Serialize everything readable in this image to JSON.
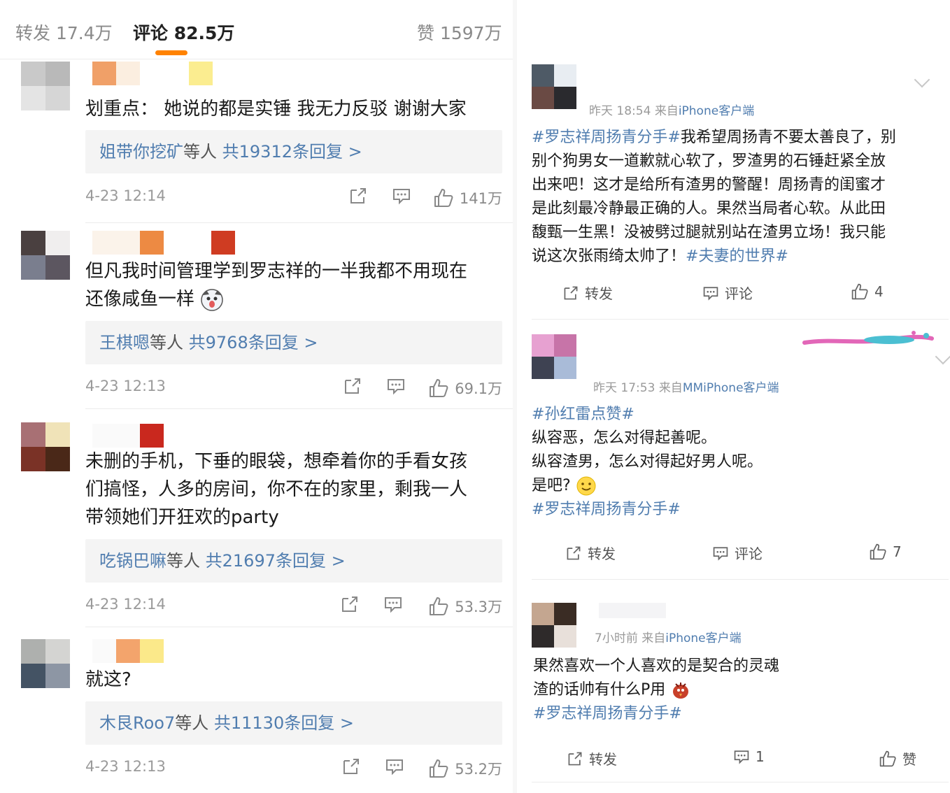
{
  "tabs": {
    "repost": "转发 17.4万",
    "comment": "评论 82.5万",
    "like": "赞 1597万"
  },
  "comments": [
    {
      "text": "划重点： 她说的都是实锤 我无力反驳 谢谢大家",
      "reply_users": "姐带你挖矿",
      "reply_mid": "等人",
      "reply_count": "共19312条回复 >",
      "time": "4-23 12:14",
      "likes": "141万"
    },
    {
      "text_line1": "但凡我时间管理学到罗志祥的一半我都不用现在",
      "text_line2": "还像咸鱼一样",
      "reply_users": "王棋嗯",
      "reply_mid": "等人",
      "reply_count": "共9768条回复 >",
      "time": "4-23 12:13",
      "likes": "69.1万"
    },
    {
      "text_line1": "未删的手机，下垂的眼袋，想牵着你的手看女孩",
      "text_line2": "们搞怪，人多的房间，你不在的家里，剩我一人",
      "text_line3": "带领她们开狂欢的party",
      "reply_users": "吃锅巴嘛",
      "reply_mid": "等人",
      "reply_count": "共21697条回复 >",
      "time": "4-23 12:14",
      "likes": "53.3万"
    },
    {
      "text": "就这?",
      "reply_users": "木艮Roo7",
      "reply_mid": "等人",
      "reply_count": "共11130条回复 >",
      "time": "4-23 12:13",
      "likes": "53.2万"
    }
  ],
  "posts": [
    {
      "time": "昨天 18:54",
      "from": "来自",
      "source": "iPhone客户端",
      "tag_open": "#罗志祥周扬青分手#",
      "body_line1": "我希望周扬青不要太善良了，别",
      "body_line2": "别个狗男女一道歉就心软了，罗渣男的石锤赶紧全放",
      "body_line3": "出来吧！这才是给所有渣男的警醒！周扬青的闺蜜才",
      "body_line4": "是此刻最冷静最正确的人。果然当局者心软。从此田",
      "body_line5": "馥甄一生黑！没被劈过腿就别站在渣男立场！我只能",
      "body_line6": "说这次张雨绮太帅了！",
      "tag_close": "#夫妻的世界#",
      "repost": "转发",
      "comment": "评论",
      "likes": "4"
    },
    {
      "time": "昨天 17:53",
      "from": "来自",
      "source": "MMiPhone客户端",
      "tag_open": "#孙红雷点赞#",
      "line1": "纵容恶，怎么对得起善呢。",
      "line2": "纵容渣男，怎么对得起好男人呢。",
      "line3": "是吧?",
      "tag_close": "#罗志祥周扬青分手#",
      "repost": "转发",
      "comment": "评论",
      "likes": "7"
    },
    {
      "time": "7小时前",
      "from": "来自",
      "source": "iPhone客户端",
      "line1": "果然喜欢一个人喜欢的是契合的灵魂",
      "line2": "渣的话帅有什么P用",
      "tag_close": "#罗志祥周扬青分手#",
      "repost": "转发",
      "comment": "1",
      "likes": "赞"
    }
  ],
  "colors": {
    "accent": "#ff8200",
    "link": "#507daf",
    "muted": "#9a9a9a"
  },
  "icons": [
    "share-icon",
    "comment-icon",
    "thumb-up-icon",
    "chevron-down-icon",
    "dog-emoji-icon",
    "smile-emoji-icon",
    "bird-emoji-icon"
  ]
}
